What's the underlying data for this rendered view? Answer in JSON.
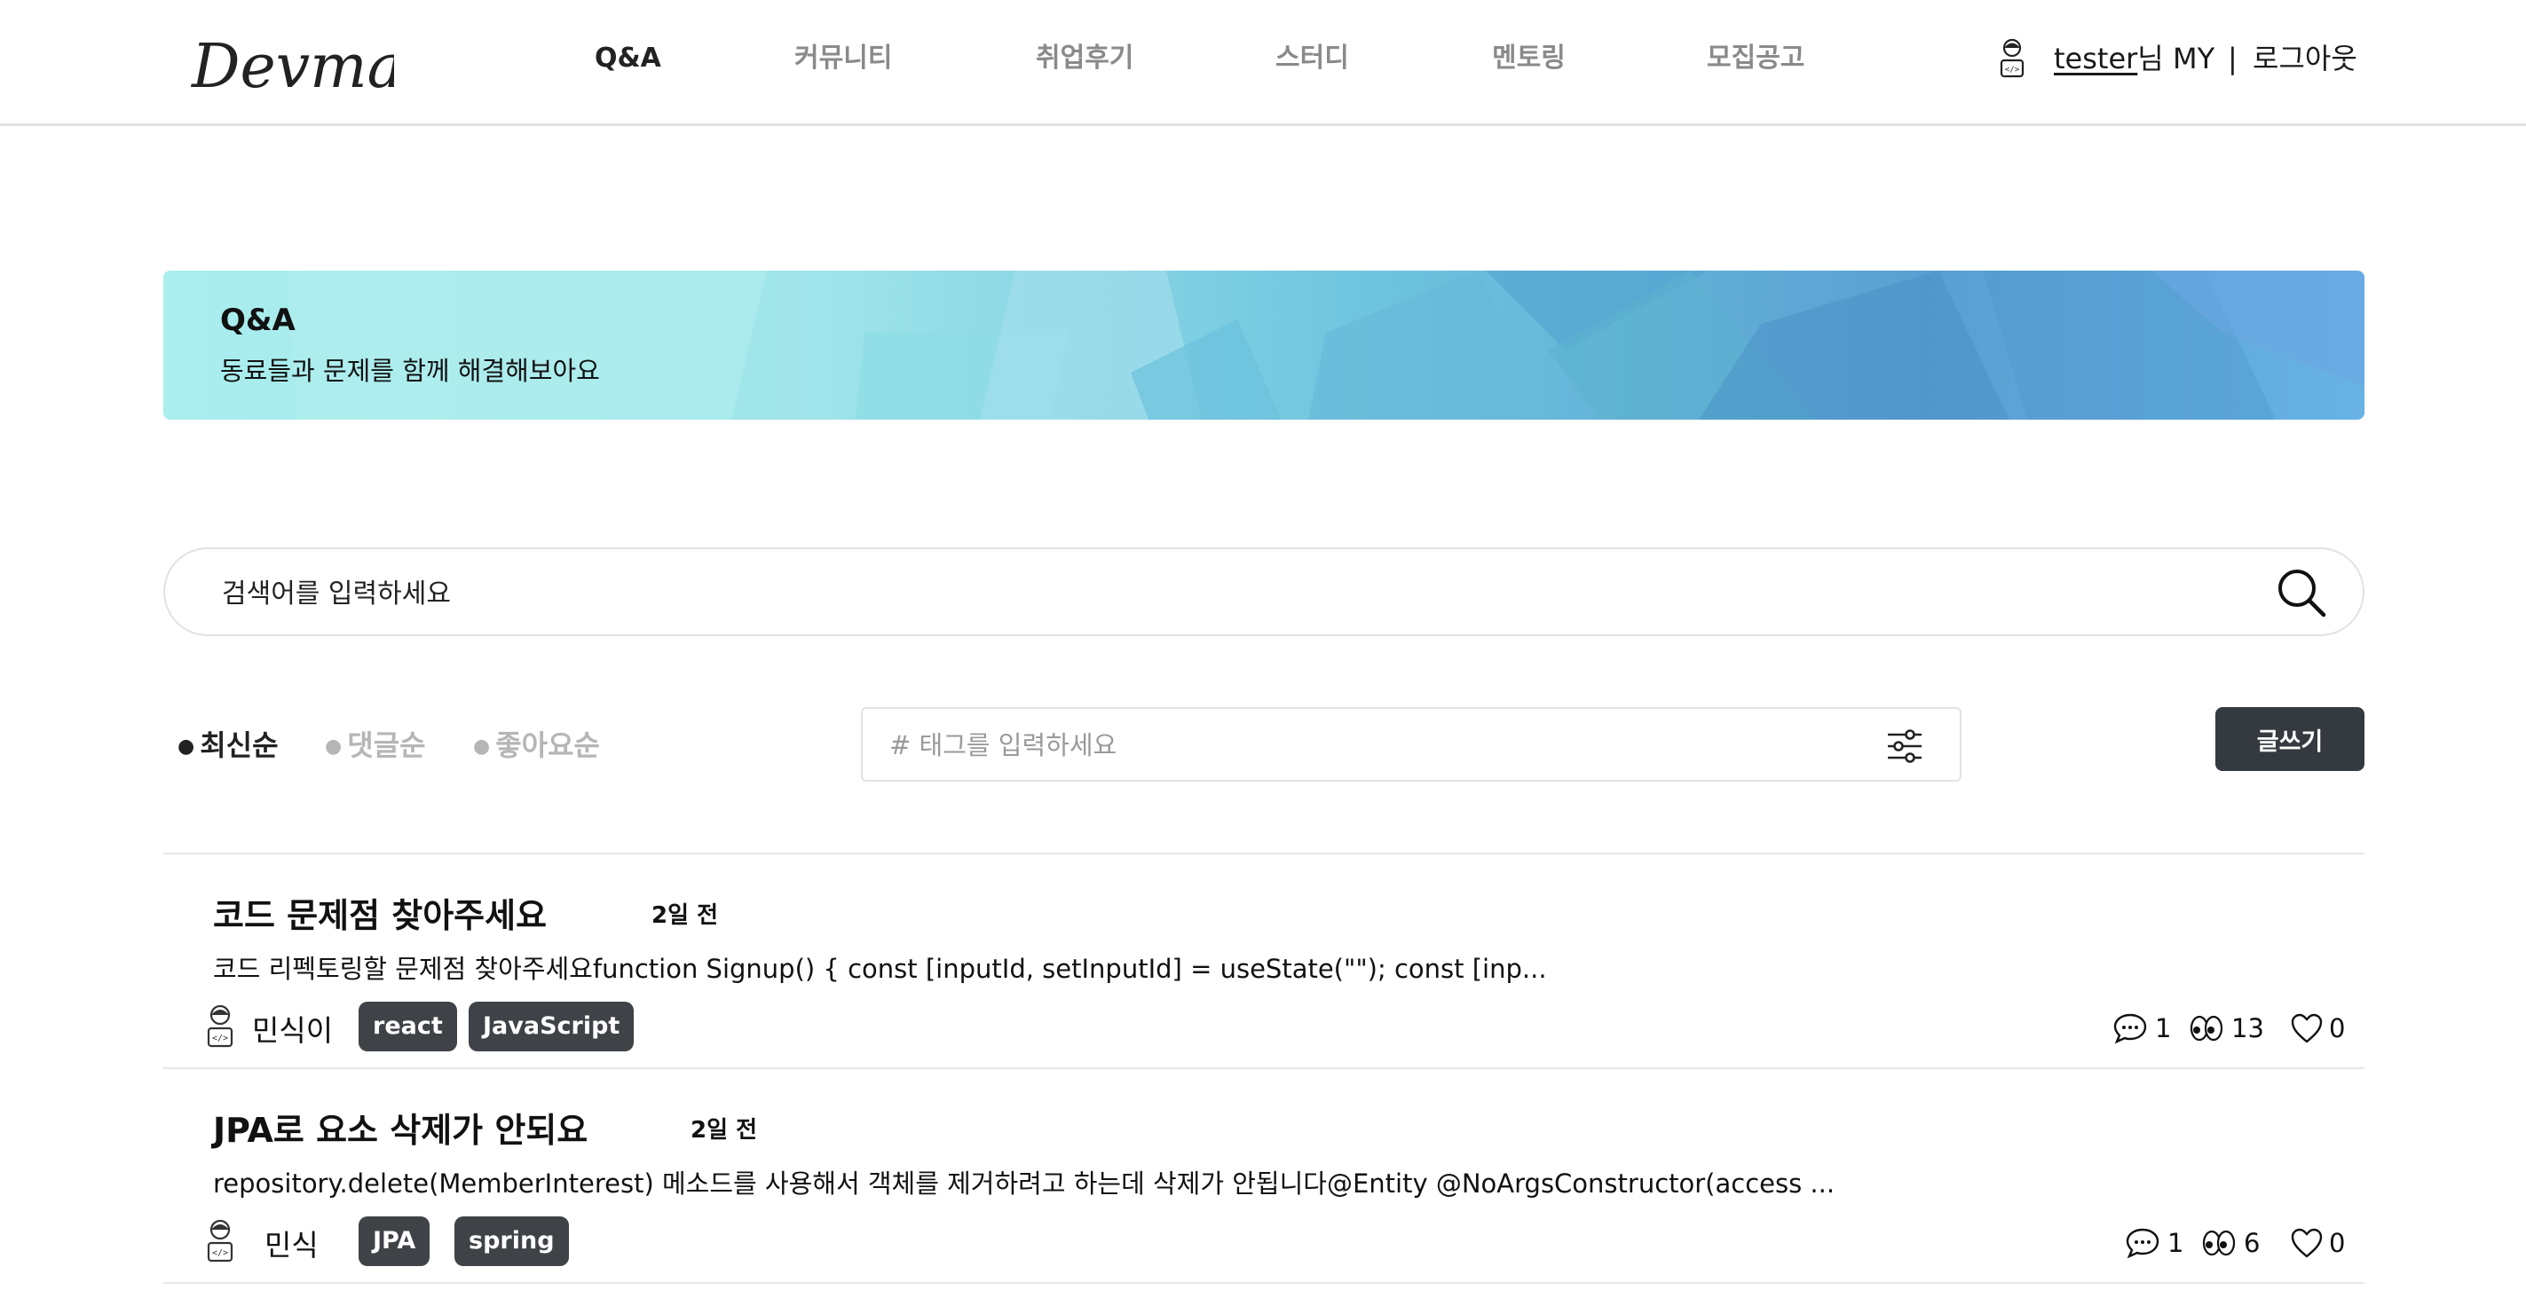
{
  "app": {
    "logo_text": "Devmate"
  },
  "nav": {
    "items": [
      {
        "label": "Q&A",
        "active": true
      },
      {
        "label": "커뮤니티",
        "active": false
      },
      {
        "label": "취업후기",
        "active": false
      },
      {
        "label": "스터디",
        "active": false
      },
      {
        "label": "멘토링",
        "active": false
      },
      {
        "label": "모집공고",
        "active": false
      }
    ]
  },
  "user": {
    "name": "tester",
    "suffix": "님",
    "my_label": "MY",
    "separator": "|",
    "logout_label": "로그아웃"
  },
  "banner": {
    "title": "Q&A",
    "subtitle": "동료들과 문제를 함께 해결해보아요"
  },
  "search": {
    "placeholder": "검색어를 입력하세요",
    "value": ""
  },
  "sort": {
    "options": [
      {
        "label": "최신순",
        "active": true
      },
      {
        "label": "댓글순",
        "active": false
      },
      {
        "label": "좋아요순",
        "active": false
      }
    ]
  },
  "tag_filter": {
    "placeholder": "# 태그를 입력하세요",
    "value": ""
  },
  "write_button": {
    "label": "글쓰기"
  },
  "posts": [
    {
      "title": "코드 문제점 찾아주세요",
      "time": "2일 전",
      "excerpt": "코드 리펙토링할 문제점 찾아주세요function Signup() { const [inputId, setInputId] = useState(\"\"); const [inp...",
      "author": "민식이",
      "tags": [
        "react",
        "JavaScript"
      ],
      "comments": "1",
      "views": "13",
      "likes": "0"
    },
    {
      "title": "JPA로 요소 삭제가 안되요",
      "time": "2일 전",
      "excerpt": "repository.delete(MemberInterest) 메소드를 사용해서 객체를 제거하려고 하는데 삭제가 안됩니다@Entity @NoArgsConstructor(access ...",
      "author": "민식",
      "tags": [
        "JPA",
        "spring"
      ],
      "comments": "1",
      "views": "6",
      "likes": "0"
    }
  ],
  "icons": {
    "avatar": "developer-avatar-icon",
    "search": "search-icon",
    "filter": "sliders-icon",
    "comment": "speech-bubble-icon",
    "views": "eyes-icon",
    "likes": "heart-icon"
  },
  "colors": {
    "banner_start": "#a9ecee",
    "banner_end": "#67aee2",
    "button_dark": "#343a40",
    "tag_bg": "#3f4347",
    "inactive_text": "#b6b6b6"
  }
}
